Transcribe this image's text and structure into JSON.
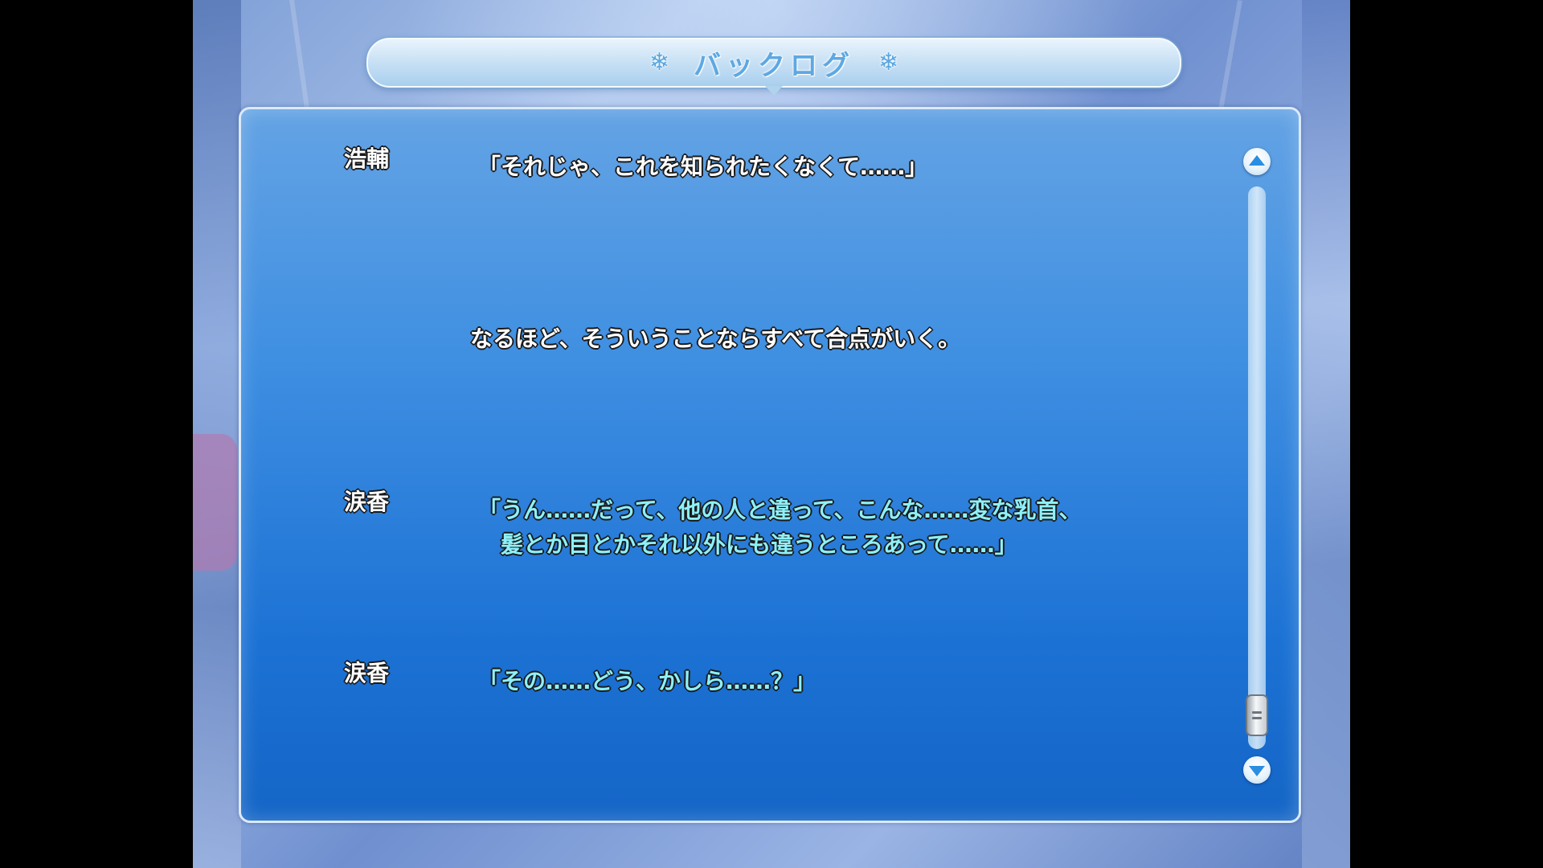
{
  "screen": {
    "title": "バックログ",
    "title_icon": "snowflake-icon"
  },
  "log": [
    {
      "speaker": "浩輔",
      "lines": [
        "「それじゃ、これを知られたくなくて……」"
      ],
      "color": "white"
    },
    {
      "speaker": "",
      "lines": [
        "なるほど、そういうことならすべて合点がいく。"
      ],
      "color": "white"
    },
    {
      "speaker": "涙香",
      "lines": [
        "「うん……だって、他の人と違って、こんな……変な乳首、",
        "　髪とか目とかそれ以外にも違うところあって……」"
      ],
      "color": "cyan"
    },
    {
      "speaker": "涙香",
      "lines": [
        "「その……どう、かしら……？」"
      ],
      "color": "cyan"
    }
  ],
  "scrollbar": {
    "up_icon": "triangle-up-icon",
    "down_icon": "triangle-down-icon",
    "position": 1.0
  },
  "colors": {
    "panel_top": "#64a3e4",
    "panel_bottom": "#1465c6",
    "narration_text": "#ffffff",
    "heroine_text": "#8ef0f8",
    "title_text": "#5ea8e2"
  }
}
